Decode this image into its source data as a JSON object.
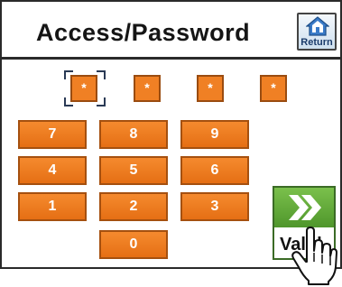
{
  "header": {
    "title": "Access/Password",
    "return_label": "Return"
  },
  "password": {
    "mask": [
      "*",
      "*",
      "*",
      "*"
    ]
  },
  "keypad": {
    "keys": [
      "7",
      "8",
      "9",
      "4",
      "5",
      "6",
      "1",
      "2",
      "3",
      "0"
    ]
  },
  "valid": {
    "label": "Valid"
  },
  "colors": {
    "key_orange": "#f08024",
    "valid_green": "#5ea836",
    "return_blue": "#3a7bc8"
  },
  "icons": {
    "return": "home-icon",
    "valid": "double-chevron-right-icon",
    "pointer": "hand-pointer-icon"
  }
}
